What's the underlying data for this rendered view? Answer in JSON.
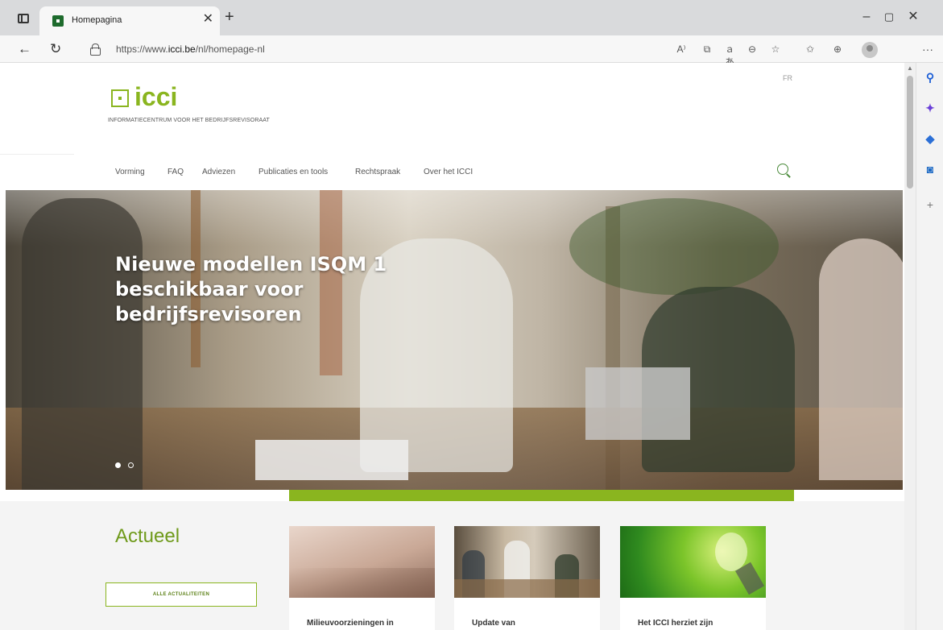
{
  "browser": {
    "tab_title": "Homepagina",
    "url_prefix": "https://www.",
    "url_domain": "icci.be",
    "url_path": "/nl/homepage-nl"
  },
  "header": {
    "lang_switch": "FR",
    "logo_text": "icci",
    "tagline": "INFORMATIECENTRUM VOOR HET BEDRIJFSREVISORAAT"
  },
  "nav": {
    "items": [
      {
        "label": "Vorming"
      },
      {
        "label": "FAQ"
      },
      {
        "label": "Adviezen"
      },
      {
        "label": "Publicaties en tools"
      },
      {
        "label": "Rechtspraak"
      },
      {
        "label": "Over het ICCI"
      }
    ]
  },
  "hero": {
    "title": "Nieuwe modellen ISQM 1 beschikbaar voor bedrijfsrevisoren",
    "slides_total": 2,
    "active_slide": 1
  },
  "news": {
    "heading": "Actueel",
    "all_button": "ALLE ACTUALITEITEN",
    "cards": [
      {
        "title": "Milieuvoorzieningen in"
      },
      {
        "title": "Update van"
      },
      {
        "title": "Het ICCI herziet zijn"
      }
    ]
  },
  "colors": {
    "brand_green": "#8ab51f",
    "heading_green": "#6f9a1b"
  }
}
